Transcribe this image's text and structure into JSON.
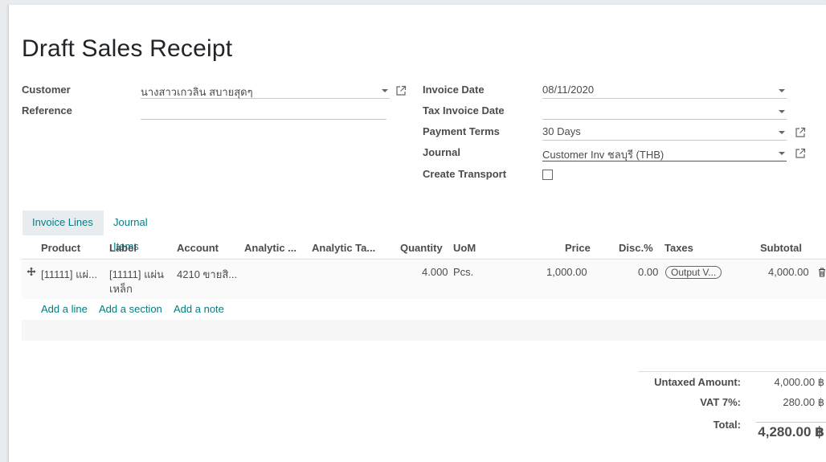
{
  "form": {
    "title": "Draft Sales Receipt",
    "customer_label": "Customer",
    "customer_value": "นางสาวเกวลิน สบายสุดๆ",
    "reference_label": "Reference",
    "reference_value": "",
    "invoice_date_label": "Invoice Date",
    "invoice_date_value": "08/11/2020",
    "tax_invoice_date_label": "Tax Invoice Date",
    "tax_invoice_date_value": "",
    "payment_terms_label": "Payment Terms",
    "payment_terms_value": "30 Days",
    "journal_label": "Journal",
    "journal_value": "Customer Inv ชลบุรี (THB)",
    "create_transport_label": "Create Transport",
    "create_transport_checked": false
  },
  "tabs": [
    {
      "label": "Invoice Lines",
      "active": true
    },
    {
      "label": "Journal Items",
      "active": false
    }
  ],
  "table": {
    "columns": [
      "Product",
      "Label",
      "Account",
      "Analytic ...",
      "Analytic Ta...",
      "Quantity",
      "UoM",
      "Price",
      "Disc.%",
      "Taxes",
      "Subtotal"
    ],
    "rows": [
      {
        "product": "[11111] แผ่...",
        "label_line1": "[11111] แผ่น",
        "label_line2": "เหล็ก",
        "account": "4210 ขายสิ...",
        "analytic_account": "",
        "analytic_tags": "",
        "quantity": "4.000",
        "uom": "Pcs.",
        "price": "1,000.00",
        "discount": "0.00",
        "taxes": "Output V...",
        "subtotal": "4,000.00"
      }
    ],
    "add_line": "Add a line",
    "add_section": "Add a section",
    "add_note": "Add a note"
  },
  "totals": {
    "untaxed_label": "Untaxed Amount:",
    "untaxed_value": "4,000.00 ฿",
    "vat_label": "VAT 7%:",
    "vat_value": "280.00 ฿",
    "total_label": "Total:",
    "total_value": "4,280.00 ฿"
  },
  "colors": {
    "link": "#017e84",
    "text": "#4c4c4c",
    "title": "#212529"
  },
  "icons": [
    "external-link-icon",
    "dropdown-caret-icon",
    "drag-handle-icon",
    "trash-icon"
  ]
}
